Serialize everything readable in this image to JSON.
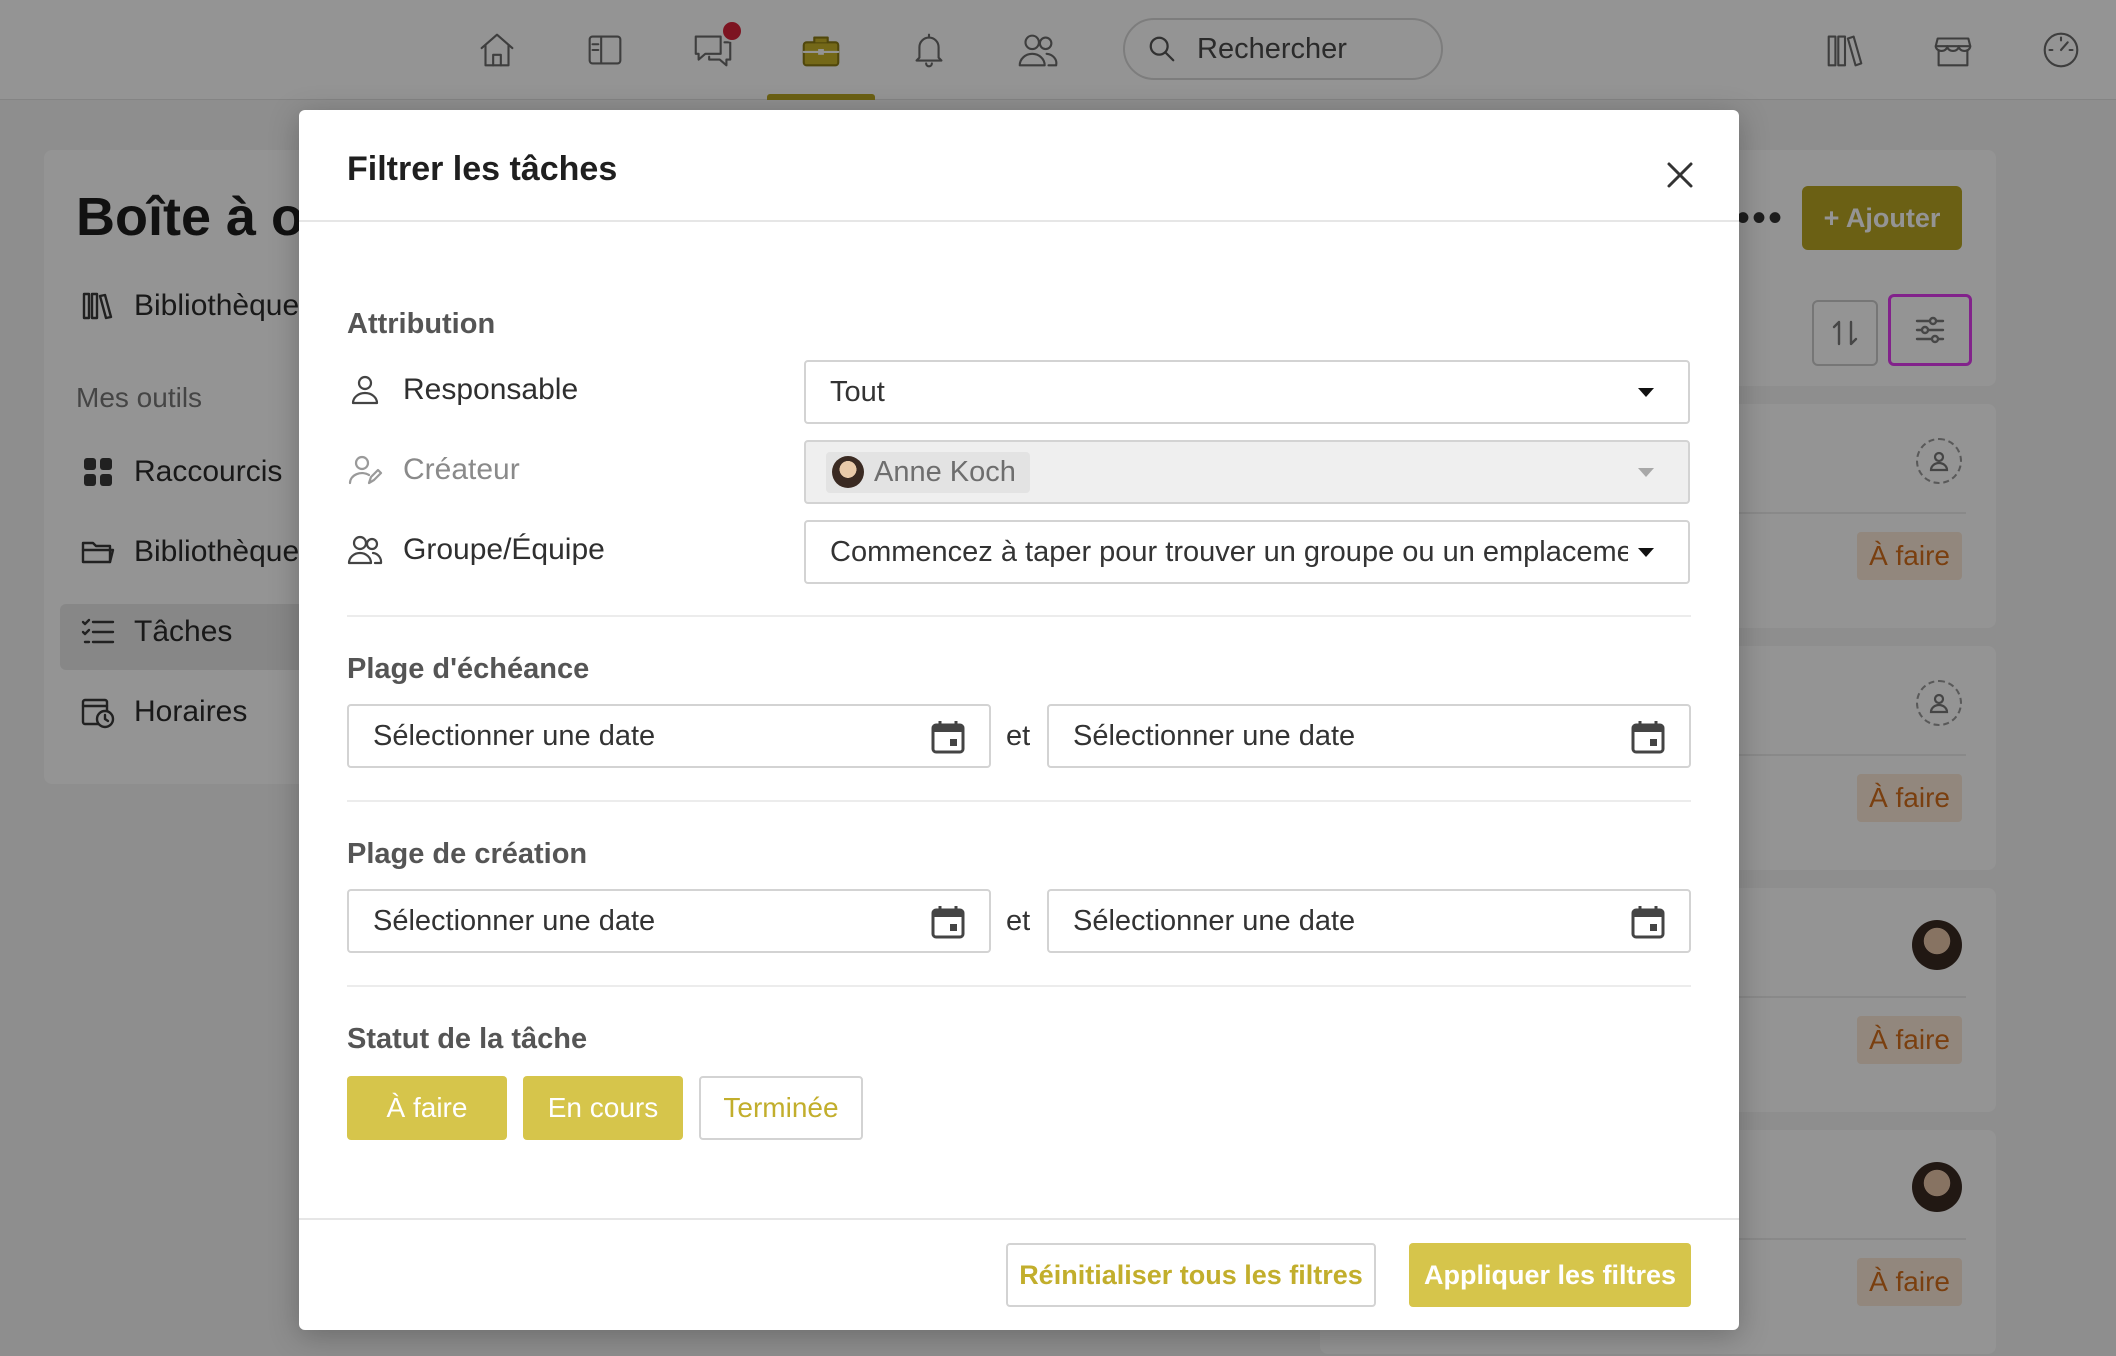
{
  "nav": {
    "items": [
      {
        "icon": "home-icon"
      },
      {
        "icon": "news-icon"
      },
      {
        "icon": "chat-icon",
        "has_notification": true
      },
      {
        "icon": "toolbox-icon",
        "active": true
      },
      {
        "icon": "bell-icon"
      },
      {
        "icon": "people-icon"
      }
    ],
    "search_placeholder": "Rechercher",
    "right_icons": [
      "library-icon",
      "store-icon",
      "dashboard-icon"
    ],
    "accent_color": "#b9a623",
    "notification_color": "#d8243a"
  },
  "background": {
    "page_title": "Boîte à ou",
    "sidebar": {
      "library_label": "Bibliothèque",
      "section_label": "Mes outils",
      "items": [
        {
          "label": "Raccourcis",
          "icon": "shortcuts-icon"
        },
        {
          "label": "Bibliothèque",
          "icon": "folder-icon"
        },
        {
          "label": "Tâches",
          "icon": "tasks-icon",
          "active": true
        },
        {
          "label": "Horaires",
          "icon": "calendar-clock-icon"
        }
      ]
    },
    "add_button": "+ Ajouter",
    "tasks": [
      {
        "status": "À faire",
        "assignee": "empty"
      },
      {
        "status": "À faire",
        "assignee": "empty"
      },
      {
        "status": "À faire",
        "assignee": "avatar"
      },
      {
        "status": "À faire",
        "assignee": "avatar"
      }
    ]
  },
  "modal": {
    "title": "Filtrer les tâches",
    "attribution": {
      "title": "Attribution",
      "responsable_label": "Responsable",
      "responsable_value": "Tout",
      "createur_label": "Créateur",
      "createur_value": "Anne Koch",
      "groupe_label": "Groupe/Équipe",
      "groupe_placeholder": "Commencez à taper pour trouver un groupe ou un emplacement"
    },
    "due_range": {
      "title": "Plage d'échéance",
      "from_placeholder": "Sélectionner une date",
      "and": "et",
      "to_placeholder": "Sélectionner une date"
    },
    "created_range": {
      "title": "Plage de création",
      "from_placeholder": "Sélectionner une date",
      "and": "et",
      "to_placeholder": "Sélectionner une date"
    },
    "status": {
      "title": "Statut de la tâche",
      "options": [
        {
          "label": "À faire",
          "selected": true
        },
        {
          "label": "En cours",
          "selected": true
        },
        {
          "label": "Terminée",
          "selected": false
        }
      ]
    },
    "reset_button": "Réinitialiser tous les filtres",
    "apply_button": "Appliquer les filtres",
    "accent_color": "#d6c54b"
  }
}
